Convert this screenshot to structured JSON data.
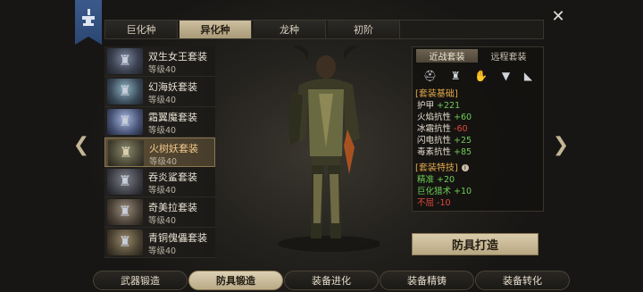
{
  "top_tabs": [
    "巨化种",
    "异化种",
    "龙种",
    "初阶"
  ],
  "active_top_tab": 1,
  "close_icon": "close-icon",
  "sets": [
    {
      "name": "双生女王套装",
      "level": "等级40"
    },
    {
      "name": "幻海妖套装",
      "level": "等级40"
    },
    {
      "name": "霜翼魔套装",
      "level": "等级40"
    },
    {
      "name": "火树妖套装",
      "level": "等级40"
    },
    {
      "name": "吞炎鲨套装",
      "level": "等级40"
    },
    {
      "name": "奇美拉套装",
      "level": "等级40"
    },
    {
      "name": "青铜傀儡套装",
      "level": "等级40"
    }
  ],
  "selected_set": 3,
  "panel": {
    "subtabs": [
      "近战套装",
      "远程套装"
    ],
    "base_title": "[套装基础]",
    "stats": [
      {
        "label": "护甲",
        "value": "+221",
        "sign": "pos"
      },
      {
        "label": "火焰抗性",
        "value": "+60",
        "sign": "pos"
      },
      {
        "label": "冰霜抗性",
        "value": "-60",
        "sign": "neg"
      },
      {
        "label": "闪电抗性",
        "value": "+25",
        "sign": "pos"
      },
      {
        "label": "毒素抗性",
        "value": "+85",
        "sign": "pos"
      }
    ],
    "special_title": "[套装特技]",
    "specials": [
      {
        "label": "精准",
        "value": "+20",
        "label_color": "pos"
      },
      {
        "label": "巨化猎术",
        "value": "+10",
        "label_color": "pos"
      },
      {
        "label": "不屈",
        "value": "-10",
        "label_color": "neg"
      }
    ]
  },
  "forge_button": "防具打造",
  "bottom_tabs": [
    "武器锻造",
    "防具锻造",
    "装备进化",
    "装备精铸",
    "装备转化"
  ],
  "active_bottom_tab": 1,
  "colors": {
    "positive": "#6fcc57",
    "negative": "#e0493f",
    "section": "#e3a94c",
    "selected_text": "#f3c98d"
  }
}
